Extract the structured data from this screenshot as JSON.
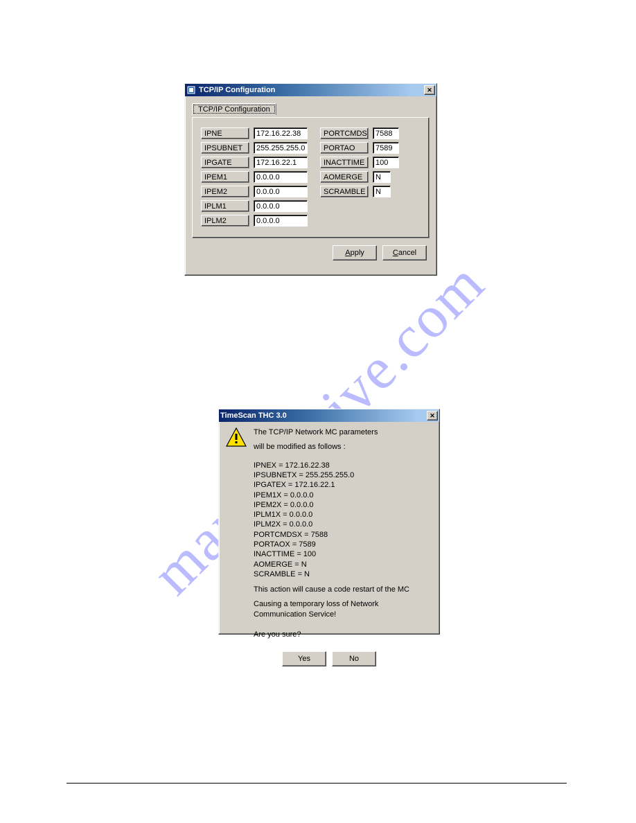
{
  "watermark": "manualshive.com",
  "win1": {
    "title": "TCP/IP Configuration",
    "tab": "TCP/IP Configuration",
    "left": [
      {
        "label": "IPNE",
        "value": "172.16.22.38"
      },
      {
        "label": "IPSUBNET",
        "value": "255.255.255.0"
      },
      {
        "label": "IPGATE",
        "value": "172.16.22.1"
      },
      {
        "label": "IPEM1",
        "value": "0.0.0.0"
      },
      {
        "label": "IPEM2",
        "value": "0.0.0.0"
      },
      {
        "label": "IPLM1",
        "value": "0.0.0.0"
      },
      {
        "label": "IPLM2",
        "value": "0.0.0.0"
      }
    ],
    "right": [
      {
        "label": "PORTCMDS",
        "value": "7588",
        "size": "w38"
      },
      {
        "label": "PORTAO",
        "value": "7589",
        "size": "w38"
      },
      {
        "label": "INACTTIME",
        "value": "100",
        "size": "w38"
      },
      {
        "label": "AOMERGE",
        "value": "N",
        "size": "w26"
      },
      {
        "label": "SCRAMBLE",
        "value": "N",
        "size": "w26"
      }
    ],
    "buttons": {
      "apply": "Apply",
      "cancel": "Cancel"
    }
  },
  "win2": {
    "title": "TimeScan THC 3.0",
    "intro1": "The TCP/IP Network MC parameters",
    "intro2": "will be modified as follows :",
    "params": [
      "IPNEX = 172.16.22.38",
      "IPSUBNETX = 255.255.255.0",
      "IPGATEX = 172.16.22.1",
      "IPEM1X = 0.0.0.0",
      "IPEM2X = 0.0.0.0",
      "IPLM1X = 0.0.0.0",
      "IPLM2X = 0.0.0.0",
      "PORTCMDSX = 7588",
      "PORTAOX = 7589",
      "INACTTIME = 100",
      "AOMERGE = N",
      "SCRAMBLE = N"
    ],
    "warn1": "This action will cause a code restart of the  MC",
    "warn2": "Causing a temporary loss of Network Communication Service!",
    "confirm": "Are you sure?",
    "buttons": {
      "yes": "Yes",
      "no": "No"
    }
  }
}
